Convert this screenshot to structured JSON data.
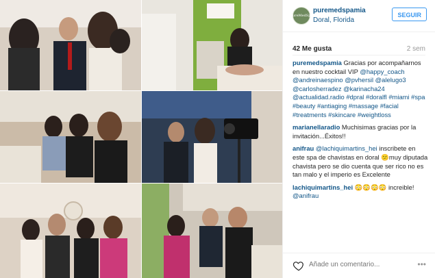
{
  "post": {
    "username": "puremedspamia",
    "location": "Doral, Florida",
    "follow_label": "SEGUIR",
    "likes": "42 Me gusta",
    "time_ago": "2 sem",
    "avatar_text": "PureMedSpa"
  },
  "comments": [
    {
      "user": "puremedspamia",
      "text": "Gracias por acompañarnos en nuestro cocktail VIP",
      "tags": "@happy_coach @andreinaespino @pvhersil @alelugo3 @carlosherradez @karinacha24 @actualidad.radio #dpral #doralfl #miami #spa #beauty #antiaging #massage #facial #treatments #skincare #weightloss"
    },
    {
      "user": "marianellaradio",
      "text": "Muchisimas gracias por la invitación...Éxitos!!",
      "tags": ""
    },
    {
      "user": "anifrau",
      "text": "inscribete en este spa de chavistas en doral 😕muy diputada chavista pero se dio cuenta que ser rico no es tan malo y el imperio es Excelente",
      "tags": "@lachiquimartins_hei"
    },
    {
      "user": "lachiquimartins_hei",
      "text": "😳😳😳😳 increible!",
      "tags": "@anifrau"
    }
  ],
  "input": {
    "placeholder": "Añade un comentario..."
  },
  "more_icon": "•••",
  "icons": {
    "heart": "heart-icon",
    "more": "more-options-icon"
  },
  "colors": {
    "link": "#125688",
    "follow": "#3897f0",
    "text": "#262626",
    "muted": "#999999"
  },
  "photos": [
    "group photo of three people at event",
    "spa treatment room with client",
    "group of women on sofa",
    "interview with camera at event",
    "group of five people posing",
    "group with drinks at event"
  ]
}
